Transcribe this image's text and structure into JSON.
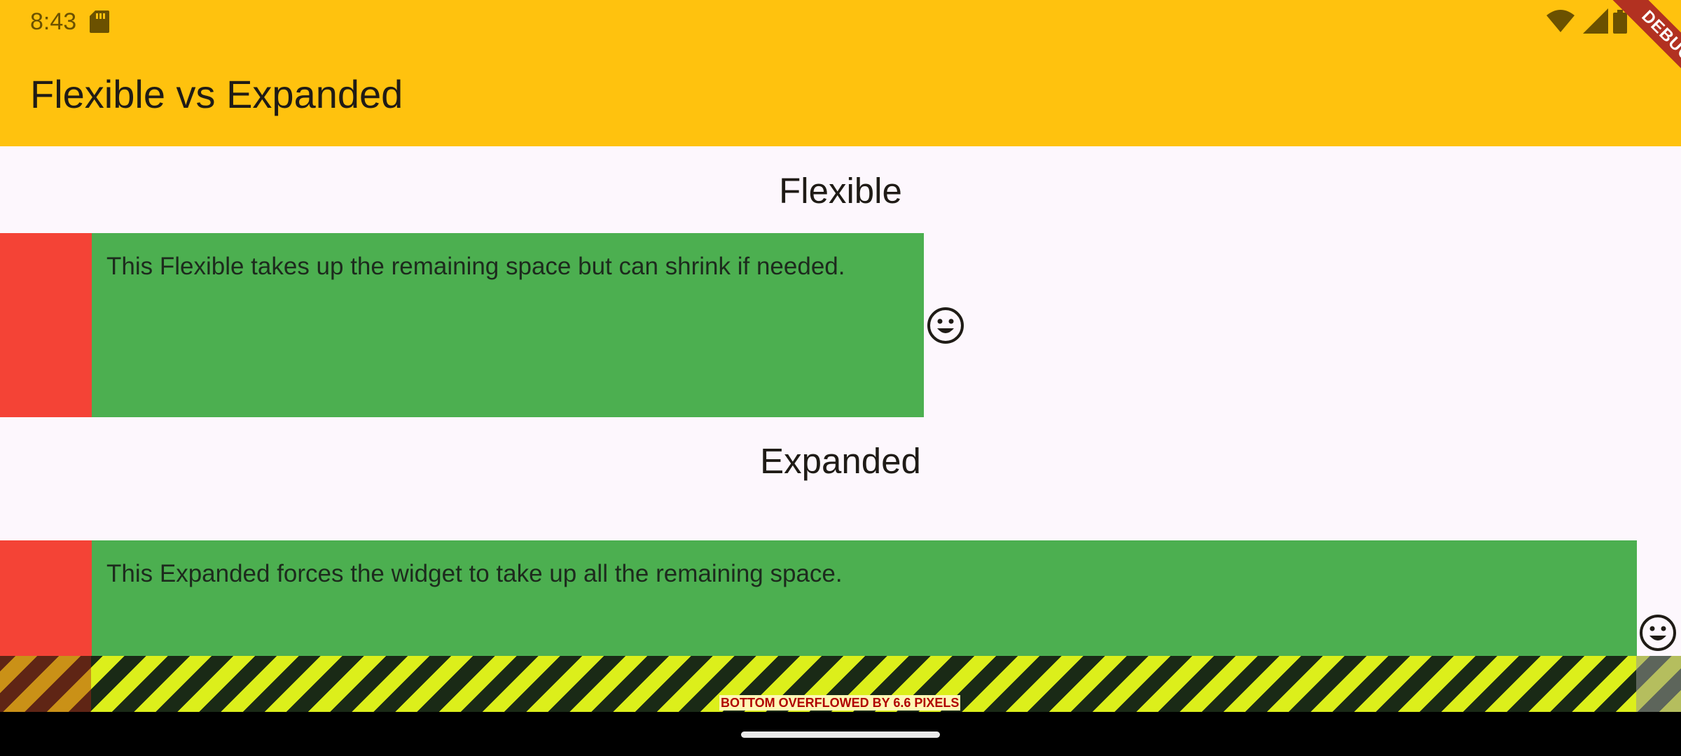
{
  "status_bar": {
    "time": "8:43",
    "icons": [
      "sd-card-icon",
      "wifi-icon",
      "signal-icon",
      "battery-icon"
    ]
  },
  "app_bar": {
    "title": "Flexible vs Expanded",
    "debug_banner": "DEBUG"
  },
  "sections": [
    {
      "heading": "Flexible",
      "text": "This Flexible takes up the remaining space but can shrink if needed.",
      "icon": "smiley-face-icon"
    },
    {
      "heading": "Expanded",
      "text": "This Expanded forces the widget to take up all the remaining space.",
      "icon": "smiley-face-icon"
    }
  ],
  "overflow_warning": {
    "label": "BOTTOM OVERFLOWED BY 6.6 PIXELS"
  },
  "colors": {
    "app_bar": "#ffc20e",
    "red_box": "#f44336",
    "green_box": "#4caf50",
    "background": "#fdf7fd"
  }
}
